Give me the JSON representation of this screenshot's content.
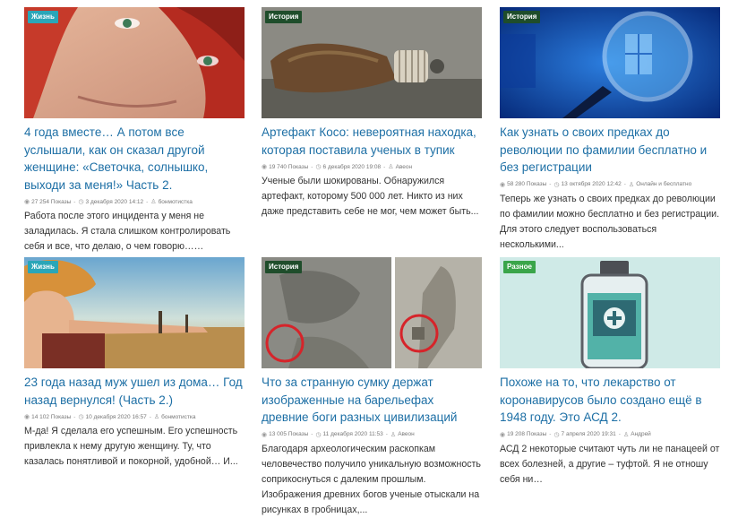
{
  "colors": {
    "link": "#1d6fa5",
    "cat_life": "#2aa6b8",
    "cat_history": "#1f4d2b",
    "cat_misc": "#3aa54a"
  },
  "cards": [
    {
      "category": "Жизнь",
      "category_color": "#2aa6b8",
      "title": "4 года вместе… А потом все услышали, как он сказал другой женщине: «Светочка, солнышко, выходи за меня!» Часть 2.",
      "views": "27 254 Показы",
      "date": "3 декабря 2020 14:12",
      "author": "бонмотистка",
      "excerpt": "Работа после этого инцидента у меня не заладилась. Я стала слишком контролировать себя и все, что делаю, о чем говорю……"
    },
    {
      "category": "История",
      "category_color": "#1f4d2b",
      "title": "Артефакт Косо: невероятная находка, которая поставила ученых в тупик",
      "views": "19 740 Показы",
      "date": "6 декабря 2020 19:08",
      "author": "Авеон",
      "excerpt": "Ученые были шокированы. Обнаружился артефакт, которому 500 000 лет. Никто из них даже представить себе не мог, чем может быть..."
    },
    {
      "category": "История",
      "category_color": "#1f4d2b",
      "title": "Как узнать о своих предках до революции по фамилии бесплатно и без регистрации",
      "views": "58 280 Показы",
      "date": "13 октября 2020 12:42",
      "author": "Онлайн и бесплатно",
      "excerpt": "Теперь же узнать о своих предках до революции по фамилии можно бесплатно и без регистрации. Для этого следует воспользоваться несколькими..."
    },
    {
      "category": "Жизнь",
      "category_color": "#2aa6b8",
      "title": "23 года назад муж ушел из дома… Год назад вернулся! (Часть 2.)",
      "views": "14 102 Показы",
      "date": "10 декабря 2020 16:57",
      "author": "бонмотистка",
      "excerpt": "М-да! Я сделала его успешным. Его успешность привлекла к нему другую женщину. Ту, что казалась понятливой и покорной, удобной… И..."
    },
    {
      "category": "История",
      "category_color": "#1f4d2b",
      "title": "Что за странную сумку держат изображенные на барельефах древние боги разных цивилизаций",
      "views": "13 005 Показы",
      "date": "11 декабря 2020 11:53",
      "author": "Авеон",
      "excerpt": "Благодаря археологическим раскопкам человечество получило уникальную возможность соприкоснуться с далеким прошлым. Изображения древних богов ученые отыскали на рисунках в гробницах,..."
    },
    {
      "category": "Разное",
      "category_color": "#3aa54a",
      "title": "Похоже на то, что лекарство от коронавирусов было создано ещё в 1948 году. Это АСД 2.",
      "views": "19 208 Показы",
      "date": "7 апреля 2020 19:31",
      "author": "Андрей",
      "excerpt": "АСД 2 некоторые считают чуть ли не панацеей от всех болезней, а другие – туфтой. Я не отношу себя ни…"
    }
  ]
}
